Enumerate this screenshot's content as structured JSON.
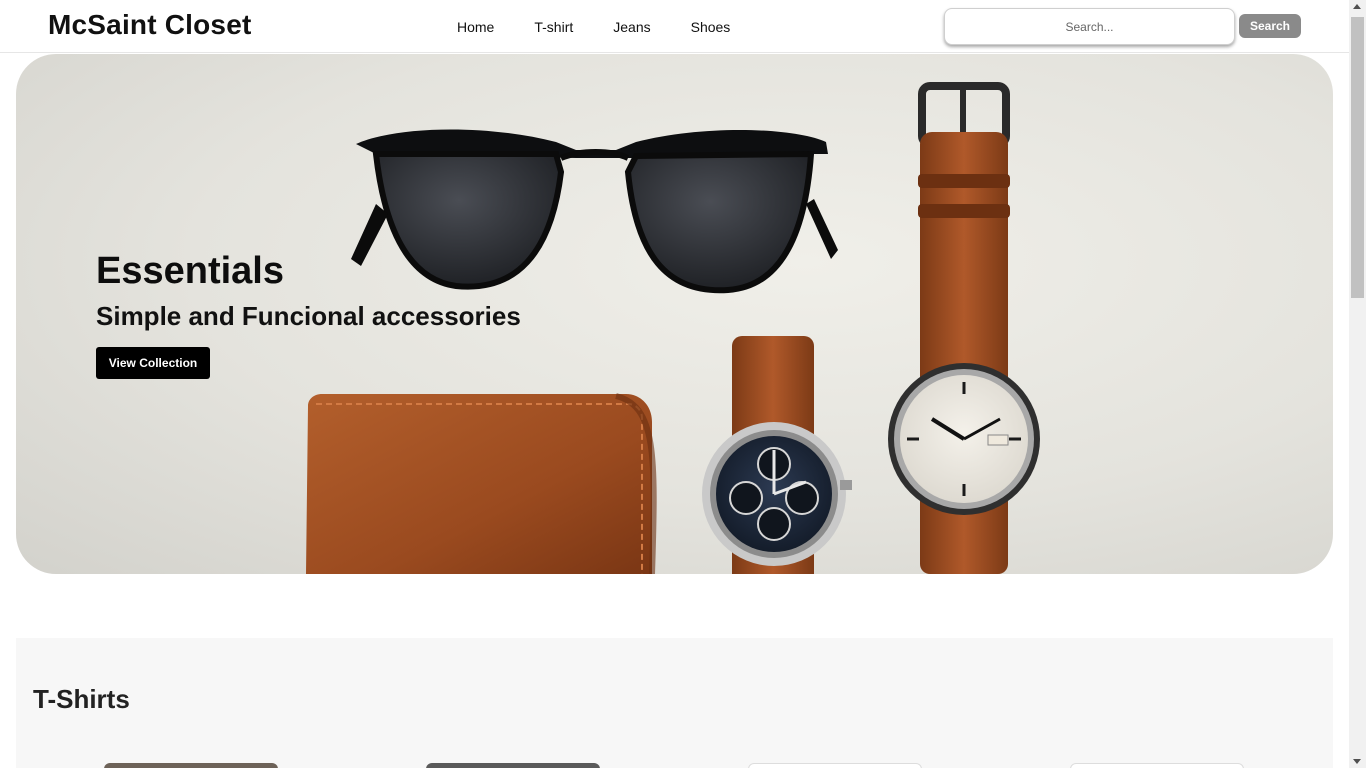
{
  "header": {
    "logo": "McSaint Closet",
    "nav": [
      "Home",
      "T-shirt",
      "Jeans",
      "Shoes"
    ],
    "search_placeholder": "Search...",
    "search_button": "Search"
  },
  "hero": {
    "title": "Essentials",
    "subtitle": "Simple and Funcional accessories",
    "button": "View Collection"
  },
  "section": {
    "title": "T-Shirts"
  },
  "icons": {
    "hero_image": "accessories-photo",
    "scroll_up": "arrow-up-icon",
    "scroll_down": "arrow-down-icon"
  },
  "colors": {
    "hero_button": "#000000",
    "search_button": "#8a8a8a",
    "section_bg": "#f7f7f7"
  }
}
